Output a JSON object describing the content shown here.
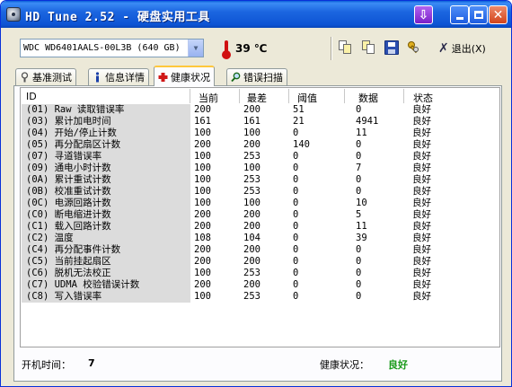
{
  "window": {
    "title": "HD Tune 2.52 - 硬盘实用工具"
  },
  "toolbar": {
    "drive": "WDC WD6401AALS-00L3B (640 GB)",
    "temperature": "39 ℃",
    "exit_label": "退出(X)"
  },
  "tabs": [
    {
      "label": "基准测试",
      "icon": "benchmark-icon"
    },
    {
      "label": "信息详情",
      "icon": "info-icon"
    },
    {
      "label": "健康状况",
      "icon": "health-cross-icon"
    },
    {
      "label": "错误扫描",
      "icon": "magnifier-icon"
    }
  ],
  "table": {
    "headers": [
      "ID",
      "当前",
      "最差",
      "阈值",
      "数据",
      "状态"
    ],
    "rows": [
      {
        "id": "(01) Raw 读取错误率",
        "current": "200",
        "worst": "200",
        "threshold": "51",
        "data": "0",
        "status": "良好"
      },
      {
        "id": "(03) 累计加电时间",
        "current": "161",
        "worst": "161",
        "threshold": "21",
        "data": "4941",
        "status": "良好"
      },
      {
        "id": "(04) 开始/停止计数",
        "current": "100",
        "worst": "100",
        "threshold": "0",
        "data": "11",
        "status": "良好"
      },
      {
        "id": "(05) 再分配扇区计数",
        "current": "200",
        "worst": "200",
        "threshold": "140",
        "data": "0",
        "status": "良好"
      },
      {
        "id": "(07) 寻道错误率",
        "current": "100",
        "worst": "253",
        "threshold": "0",
        "data": "0",
        "status": "良好"
      },
      {
        "id": "(09) 通电小时计数",
        "current": "100",
        "worst": "100",
        "threshold": "0",
        "data": "7",
        "status": "良好"
      },
      {
        "id": "(0A) 累计重试计数",
        "current": "100",
        "worst": "253",
        "threshold": "0",
        "data": "0",
        "status": "良好"
      },
      {
        "id": "(0B) 校准重试计数",
        "current": "100",
        "worst": "253",
        "threshold": "0",
        "data": "0",
        "status": "良好"
      },
      {
        "id": "(0C) 电源回路计数",
        "current": "100",
        "worst": "100",
        "threshold": "0",
        "data": "10",
        "status": "良好"
      },
      {
        "id": "(C0) 断电缩进计数",
        "current": "200",
        "worst": "200",
        "threshold": "0",
        "data": "5",
        "status": "良好"
      },
      {
        "id": "(C1) 载入回路计数",
        "current": "200",
        "worst": "200",
        "threshold": "0",
        "data": "11",
        "status": "良好"
      },
      {
        "id": "(C2) 温度",
        "current": "108",
        "worst": "104",
        "threshold": "0",
        "data": "39",
        "status": "良好"
      },
      {
        "id": "(C4) 再分配事件计数",
        "current": "200",
        "worst": "200",
        "threshold": "0",
        "data": "0",
        "status": "良好"
      },
      {
        "id": "(C5) 当前挂起扇区",
        "current": "200",
        "worst": "200",
        "threshold": "0",
        "data": "0",
        "status": "良好"
      },
      {
        "id": "(C6) 脱机无法校正",
        "current": "100",
        "worst": "253",
        "threshold": "0",
        "data": "0",
        "status": "良好"
      },
      {
        "id": "(C7) UDMA 校验错误计数",
        "current": "200",
        "worst": "200",
        "threshold": "0",
        "data": "0",
        "status": "良好"
      },
      {
        "id": "(C8) 写入错误率",
        "current": "100",
        "worst": "253",
        "threshold": "0",
        "data": "0",
        "status": "良好"
      }
    ]
  },
  "status": {
    "power_on_label": "开机时间：",
    "power_on_value": "7",
    "health_label": "健康状况：",
    "health_value": "良好",
    "health_color": "#1a9a1a"
  }
}
